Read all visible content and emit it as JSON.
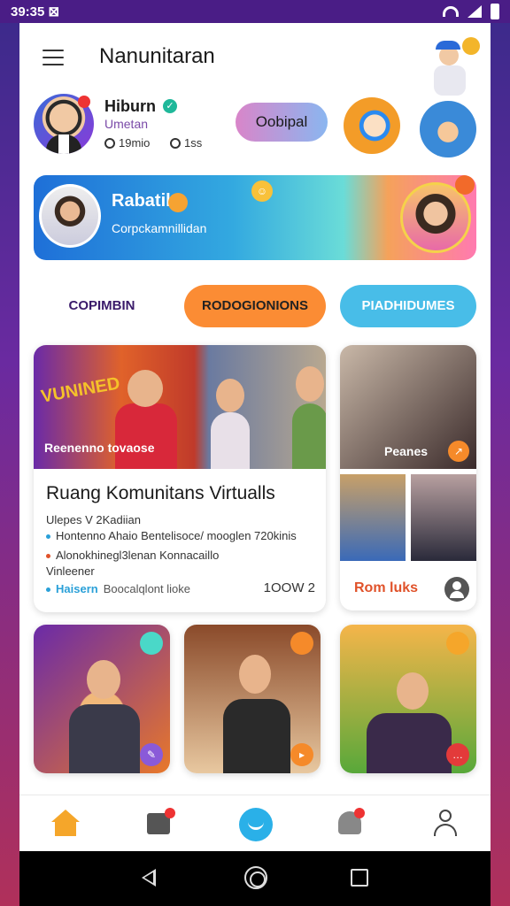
{
  "status_bar": {
    "time": "39:35 ⊠"
  },
  "header": {
    "title": "Nanunitaran"
  },
  "profile": {
    "name": "Hiburn",
    "role": "Umetan",
    "stat_1": "19mio",
    "stat_2": "1ss",
    "action_label": "Oobipal"
  },
  "banner": {
    "title": "Rabatil",
    "subtitle": "Corpckamnillidan"
  },
  "tabs": [
    {
      "label": "COPIMBIN"
    },
    {
      "label": "RODOGIONIONS"
    },
    {
      "label": "PIADHIDUMES"
    }
  ],
  "feature_card": {
    "image_text": "VUNINED",
    "image_caption": "Reenenno tovaose",
    "title": "Ruang Komunitans Virtualls",
    "lines": [
      "Ulepes V 2Kadiian",
      "Hontenno Ahaio Bentelisoce/ mooglen 720kinis",
      "Alonokhinegl3lenan Konnacaillo",
      "Vinleener"
    ],
    "footer_tag": "Haisern",
    "footer_text": "Boocalqlont lioke",
    "count": "1OOW 2"
  },
  "side_card": {
    "caption": "Peanes",
    "label": "Rom luks"
  },
  "colors": {
    "accent_orange": "#fb8c34",
    "accent_blue": "#48bde8",
    "nav_home": "#f5a62a"
  },
  "icons": [
    "menu-icon",
    "verified-icon",
    "home-icon",
    "media-icon",
    "chat-icon",
    "notification-icon",
    "profile-icon"
  ]
}
